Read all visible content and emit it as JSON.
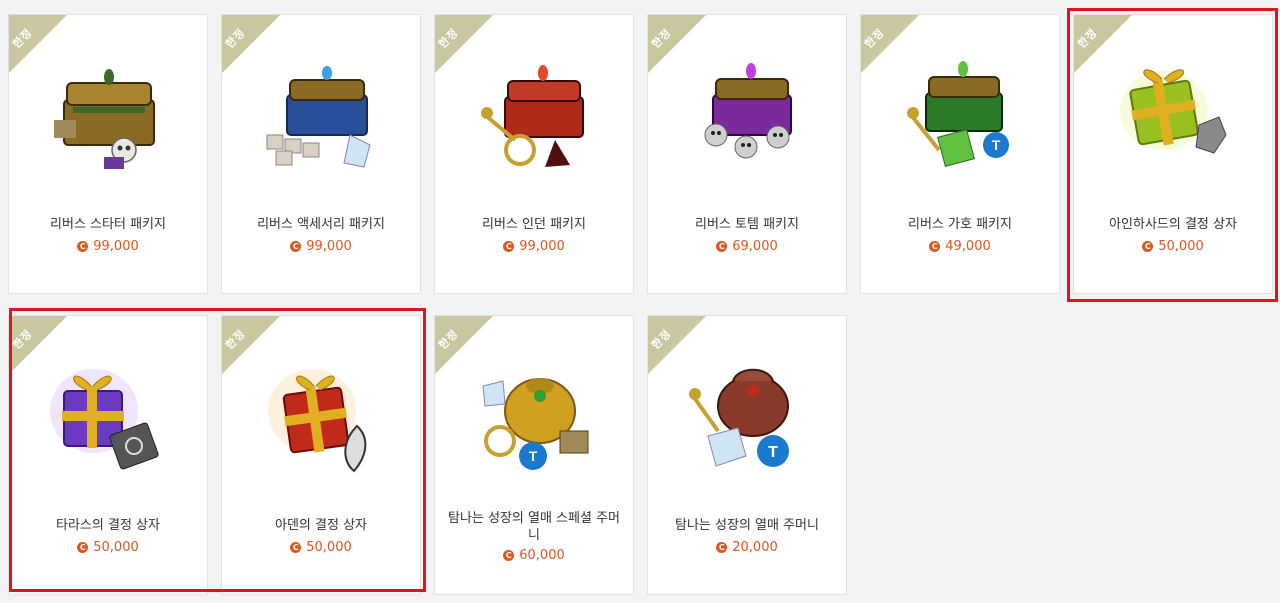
{
  "products": [
    {
      "badge": "한정",
      "name": "리버스 스타터 패키지",
      "price": "99,000",
      "icon": "chest-gold-skull",
      "colors": {
        "box": "#8a6a24",
        "gem": "#3a6a2a",
        "accent": "#6a3a9a"
      }
    },
    {
      "badge": "한정",
      "name": "리버스 액세서리 패키지",
      "price": "99,000",
      "icon": "chest-blue-boxes",
      "colors": {
        "box": "#2a4f9a",
        "gem": "#3aa0e0",
        "accent": "#d8d0c0"
      }
    },
    {
      "badge": "한정",
      "name": "리버스 인던 패키지",
      "price": "99,000",
      "icon": "chest-red-key",
      "colors": {
        "box": "#b02a1a",
        "gem": "#e04a2a",
        "accent": "#c8a030"
      }
    },
    {
      "badge": "한정",
      "name": "리버스 토템 패키지",
      "price": "69,000",
      "icon": "chest-purple-skulls",
      "colors": {
        "box": "#7a2a9a",
        "gem": "#c040e0",
        "accent": "#cfcfcf"
      }
    },
    {
      "badge": "한정",
      "name": "리버스 가호 패키지",
      "price": "49,000",
      "icon": "chest-green-apple",
      "colors": {
        "box": "#2a7a2a",
        "gem": "#60c040",
        "accent": "#1a7ad0"
      }
    },
    {
      "badge": "한정",
      "name": "아인하사드의 결정 상자",
      "price": "50,000",
      "icon": "gift-green-leaf",
      "colors": {
        "box": "#9ac020",
        "gem": "#e0b020",
        "accent": "#8a8a8a"
      }
    },
    {
      "badge": "한정",
      "name": "타라스의 결정 상자",
      "price": "50,000",
      "icon": "gift-purple-book",
      "colors": {
        "box": "#6a3ac0",
        "gem": "#e0b020",
        "accent": "#555555"
      }
    },
    {
      "badge": "한정",
      "name": "아덴의 결정 상자",
      "price": "50,000",
      "icon": "gift-red-feather",
      "colors": {
        "box": "#c02a1a",
        "gem": "#e0b020",
        "accent": "#dddddd"
      }
    },
    {
      "badge": "한정",
      "name": "탐나는 성장의 열매 스페셜 주머니",
      "price": "60,000",
      "icon": "pouch-gold-apple",
      "colors": {
        "box": "#d0a020",
        "gem": "#30a030",
        "accent": "#1a7ad0"
      }
    },
    {
      "badge": "한정",
      "name": "탐나는 성장의 열매 주머니",
      "price": "20,000",
      "icon": "pouch-red-apple",
      "colors": {
        "box": "#8a3a2a",
        "gem": "#c02a1a",
        "accent": "#1a7ad0"
      }
    }
  ],
  "highlight_color": "#e0141e",
  "badge_color": "#c9c7a0",
  "price_color": "#e0561f"
}
